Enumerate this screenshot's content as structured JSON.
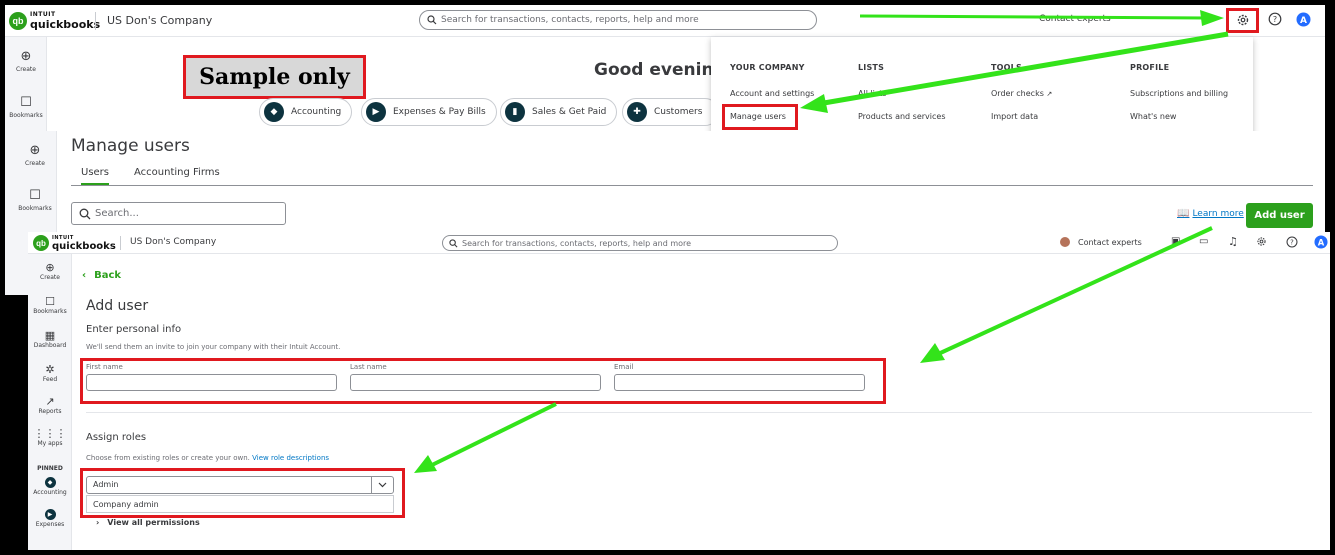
{
  "brand": {
    "intuit": "INTUIT",
    "product": "quickbooks",
    "qb_mark": "qb"
  },
  "company": "US Don's Company",
  "search_placeholder": "Search for transactions, contacts, reports, help and more",
  "topbar": {
    "contact_experts": "Contact experts"
  },
  "left_rail": {
    "create": "Create",
    "bookmarks": "Bookmarks",
    "dashboard": "Dashboard",
    "feed": "Feed",
    "reports": "Reports",
    "my_apps": "My apps",
    "pinned": "PINNED",
    "accounting": "Accounting",
    "expenses": "Expenses"
  },
  "home": {
    "greeting": "Good evening",
    "sample_label": "Sample only",
    "pills": [
      "Accounting",
      "Expenses & Pay Bills",
      "Sales & Get Paid",
      "Customers"
    ]
  },
  "settings_menu": {
    "your_company": {
      "title": "YOUR COMPANY",
      "items": [
        "Account and settings",
        "Manage users"
      ]
    },
    "lists": {
      "title": "LISTS",
      "items": [
        "All lists",
        "Products and services"
      ]
    },
    "tools": {
      "title": "TOOLS",
      "items": [
        "Order checks",
        "Import data"
      ]
    },
    "profile": {
      "title": "PROFILE",
      "items": [
        "Subscriptions and billing",
        "What's new"
      ]
    }
  },
  "manage_users": {
    "title": "Manage users",
    "tabs": [
      "Users",
      "Accounting Firms"
    ],
    "search_placeholder": "Search...",
    "learn_more": "Learn more",
    "add_user": "Add user"
  },
  "add_user_form": {
    "back": "Back",
    "title": "Add user",
    "personal_info_title": "Enter personal info",
    "personal_info_note": "We'll send them an invite to join your company with their Intuit Account.",
    "first_name_label": "First name",
    "last_name_label": "Last name",
    "email_label": "Email",
    "roles_title": "Assign roles",
    "roles_note": "Choose from existing roles or create your own.",
    "roles_link": "View role descriptions",
    "role_value": "Admin",
    "role_option": "Company admin",
    "view_all_permissions": "View all permissions"
  },
  "colors": {
    "brand_green": "#2ca01c",
    "annotation_red": "#e0191f",
    "annotation_arrow": "#33e31a",
    "link_blue": "#0077c5"
  }
}
